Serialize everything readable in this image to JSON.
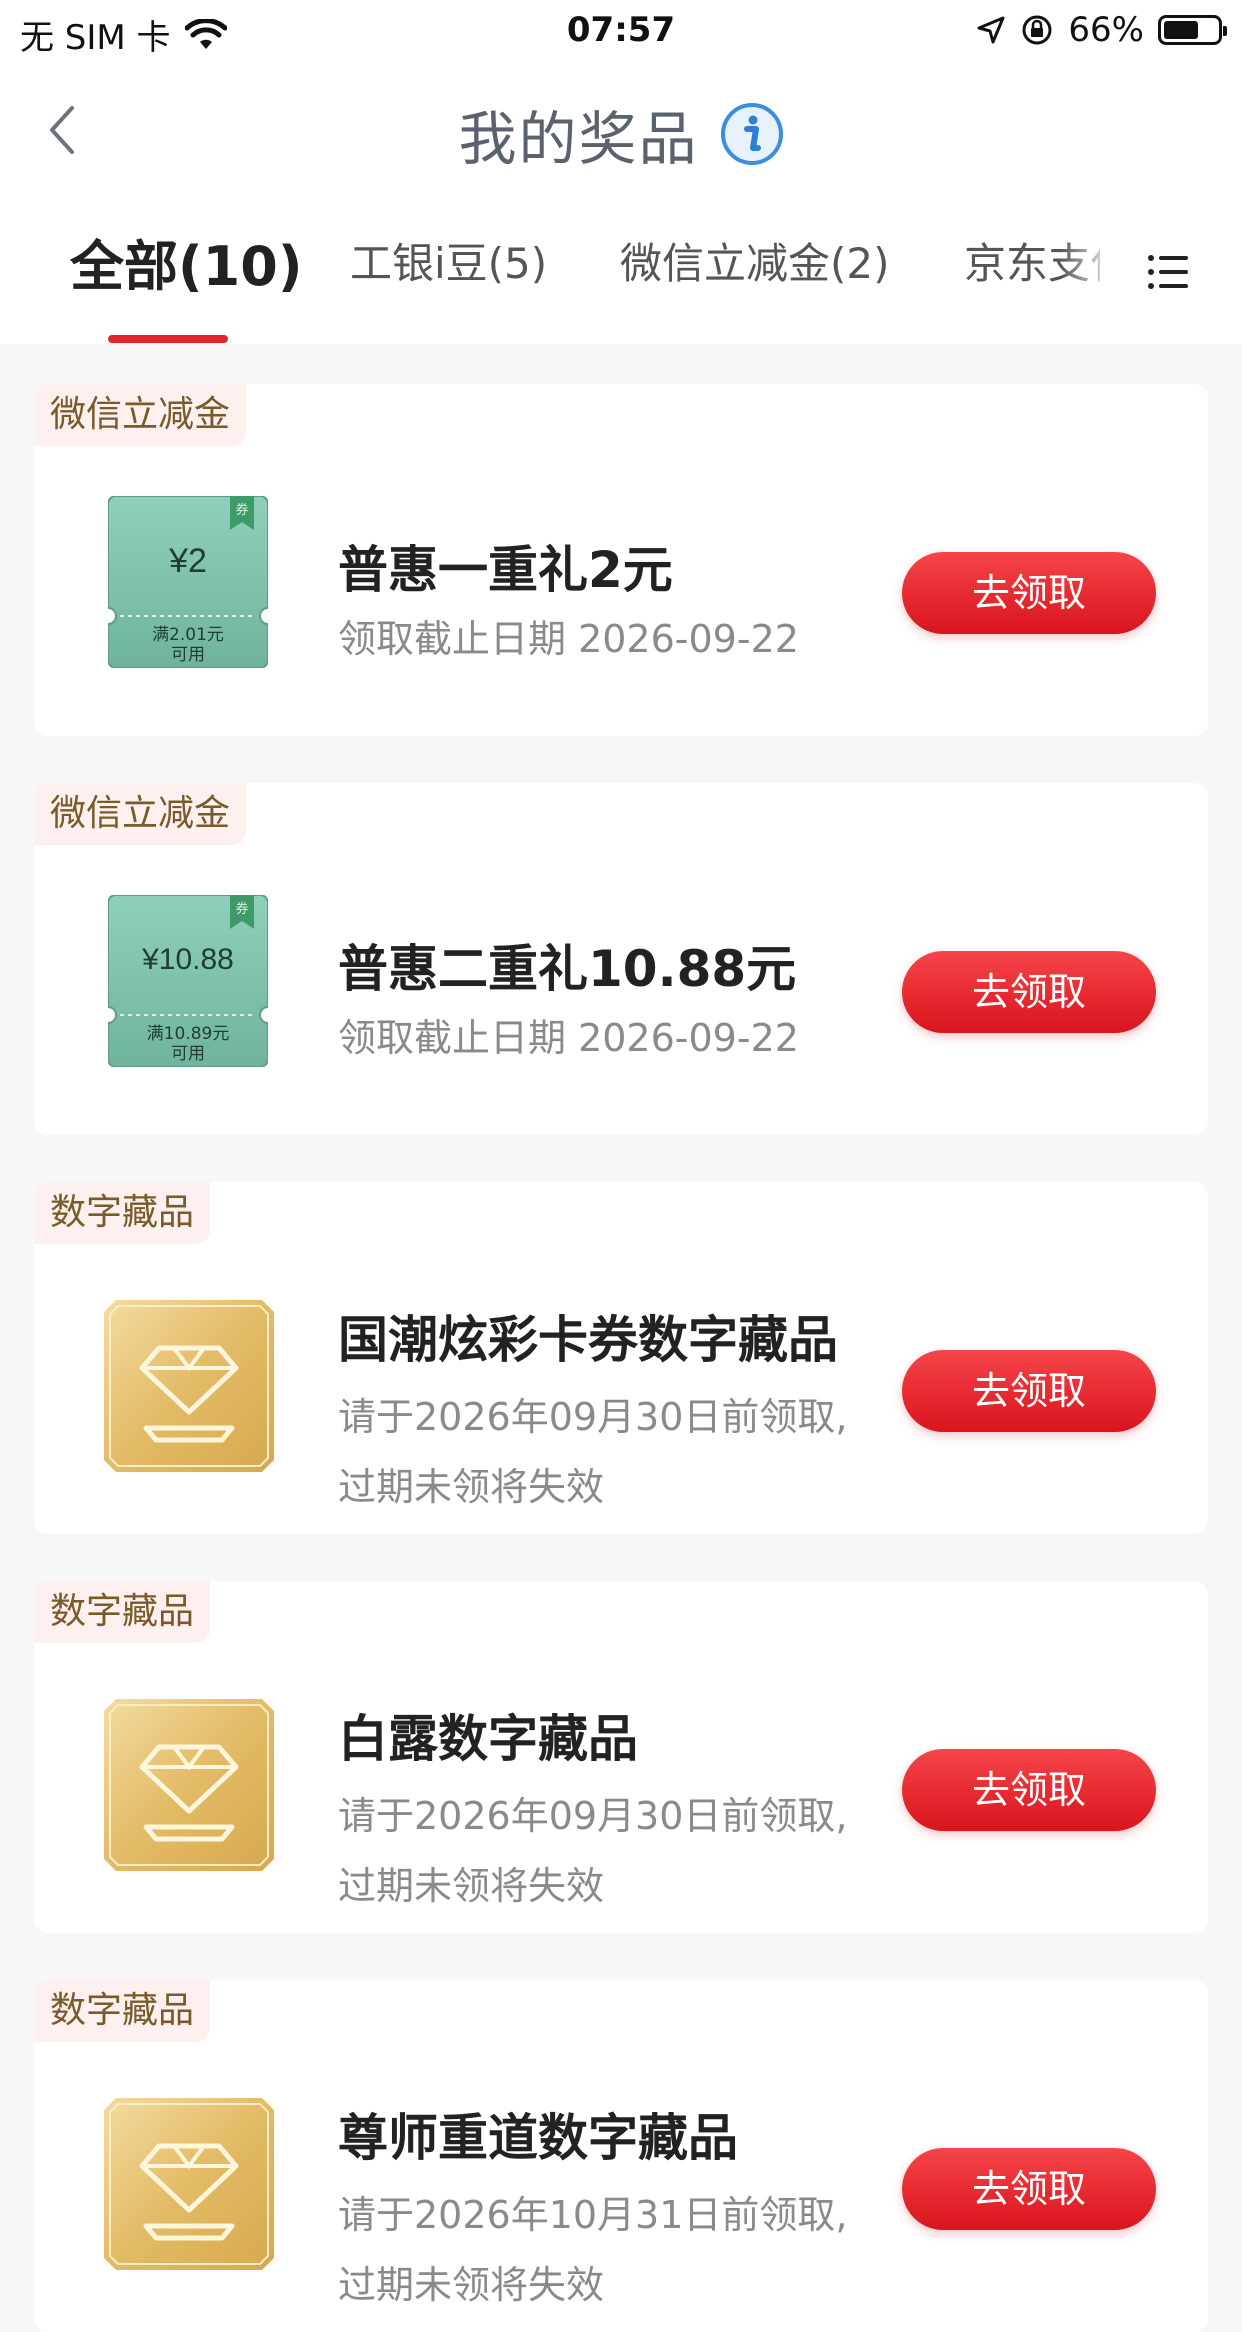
{
  "status_bar": {
    "carrier": "无 SIM 卡",
    "time": "07:57",
    "battery_percent": "66%"
  },
  "nav": {
    "title": "我的奖品"
  },
  "tabs": [
    {
      "label": "全部(10)",
      "active": true
    },
    {
      "label": "工银i豆(5)",
      "active": false
    },
    {
      "label": "微信立减金(2)",
      "active": false
    },
    {
      "label": "京东支付",
      "active": false
    }
  ],
  "items": [
    {
      "tag": "微信立减金",
      "kind": "coupon",
      "coupon_amount": "¥2",
      "coupon_condition": "满2.01元",
      "coupon_usable": "可用",
      "coupon_badge": "券",
      "title": "普惠一重礼2元",
      "subtitle": "领取截止日期 2026-09-22",
      "button": "去领取"
    },
    {
      "tag": "微信立减金",
      "kind": "coupon",
      "coupon_amount": "¥10.88",
      "coupon_condition": "满10.89元",
      "coupon_usable": "可用",
      "coupon_badge": "券",
      "title": "普惠二重礼10.88元",
      "subtitle": "领取截止日期 2026-09-22",
      "button": "去领取"
    },
    {
      "tag": "数字藏品",
      "kind": "nft",
      "title": "国潮炫彩卡券数字藏品",
      "subtitle": "请于2026年09月30日前领取,",
      "subtitle2": "过期未领将失效",
      "button": "去领取"
    },
    {
      "tag": "数字藏品",
      "kind": "nft",
      "title": "白露数字藏品",
      "subtitle": "请于2026年09月30日前领取,",
      "subtitle2": "过期未领将失效",
      "button": "去领取"
    },
    {
      "tag": "数字藏品",
      "kind": "nft",
      "title": "尊师重道数字藏品",
      "subtitle": "请于2026年10月31日前领取,",
      "subtitle2": "过期未领将失效",
      "button": "去领取"
    }
  ],
  "colors": {
    "accent_red": "#e3262e",
    "tag_bg": "#fdf0ef",
    "coupon_green": "#7cc0ac",
    "nft_gold": "#e6c06e"
  }
}
